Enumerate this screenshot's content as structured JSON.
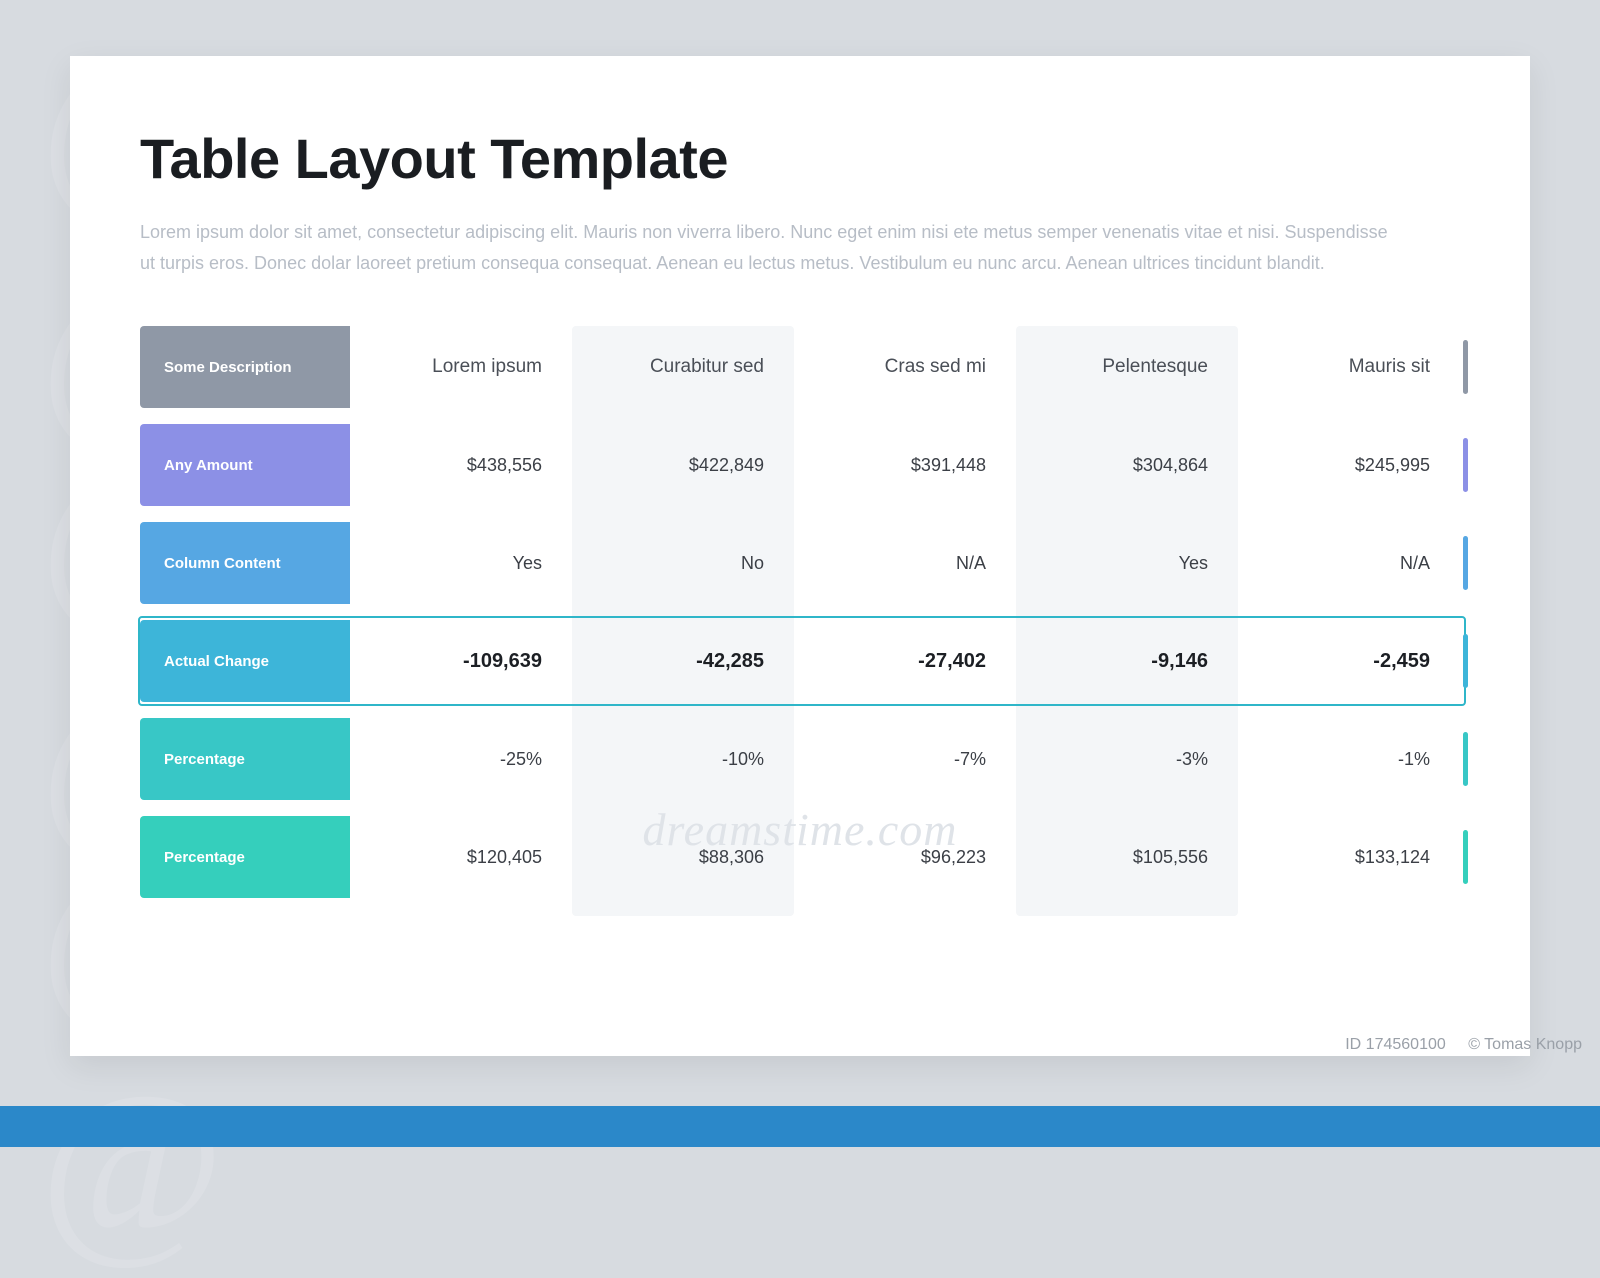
{
  "title": "Table Layout Template",
  "subtitle": "Lorem ipsum dolor sit amet, consectetur adipiscing elit. Mauris non viverra libero. Nunc eget enim nisi ete metus semper venenatis vitae et nisi. Suspendisse ut turpis eros. Donec dolar laoreet pretium consequa consequat. Aenean eu lectus metus. Vestibulum eu nunc arcu. Aenean ultrices tincidunt blandit.",
  "watermark_site": "dreamstime.com",
  "credit_id": "ID 174560100",
  "credit_author": "© Tomas Knopp",
  "columns": [
    "Lorem ipsum",
    "Curabitur sed",
    "Cras sed mi",
    "Pelentesque",
    "Mauris sit"
  ],
  "rows": [
    {
      "label": "Some Description",
      "cells": [
        "Lorem ipsum",
        "Curabitur sed",
        "Cras sed mi",
        "Pelentesque",
        "Mauris sit"
      ]
    },
    {
      "label": "Any Amount",
      "cells": [
        "$438,556",
        "$422,849",
        "$391,448",
        "$304,864",
        "$245,995"
      ]
    },
    {
      "label": "Column Content",
      "cells": [
        "Yes",
        "No",
        "N/A",
        "Yes",
        "N/A"
      ]
    },
    {
      "label": "Actual Change",
      "cells": [
        "-109,639",
        "-42,285",
        "-27,402",
        "-9,146",
        "-2,459"
      ]
    },
    {
      "label": "Percentage",
      "cells": [
        "-25%",
        "-10%",
        "-7%",
        "-3%",
        "-1%"
      ]
    },
    {
      "label": "Percentage",
      "cells": [
        "$120,405",
        "$88,306",
        "$96,223",
        "$105,556",
        "$133,124"
      ]
    }
  ],
  "chart_data": {
    "type": "table",
    "title": "Table Layout Template",
    "column_headers": [
      "",
      "Lorem ipsum",
      "Curabitur sed",
      "Cras sed mi",
      "Pelentesque",
      "Mauris sit"
    ],
    "rows": [
      [
        "Any Amount",
        438556,
        422849,
        391448,
        304864,
        245995
      ],
      [
        "Column Content",
        "Yes",
        "No",
        "N/A",
        "Yes",
        "N/A"
      ],
      [
        "Actual Change",
        -109639,
        -42285,
        -27402,
        -9146,
        -2459
      ],
      [
        "Percentage",
        -25,
        -10,
        -7,
        -3,
        -1
      ],
      [
        "Percentage",
        120405,
        88306,
        96223,
        105556,
        133124
      ]
    ],
    "highlighted_row_index": 2
  }
}
